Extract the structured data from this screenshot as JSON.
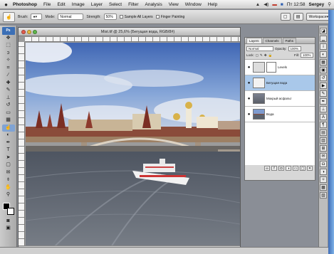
{
  "menubar": {
    "items": [
      "Photoshop",
      "File",
      "Edit",
      "Image",
      "Layer",
      "Select",
      "Filter",
      "Analysis",
      "View",
      "Window",
      "Help"
    ],
    "clock": "Пт 12:58",
    "user": "Sergey"
  },
  "options": {
    "brush_label": "Brush:",
    "mode_label": "Mode:",
    "mode_value": "Normal",
    "strength_label": "Strength:",
    "strength_value": "50%",
    "sample_all": "Sample All Layers",
    "finger": "Finger Painting",
    "workspace": "Workspace"
  },
  "document": {
    "title": "Mist.tif @ 25,6% (Бегущая вода, RGB/8#)"
  },
  "layers_panel": {
    "tabs": [
      "Layers",
      "Channels",
      "Paths"
    ],
    "blend_mode": "Normal",
    "opacity_label": "Opacity:",
    "opacity": "100%",
    "lock_label": "Lock:",
    "fill_label": "Fill:",
    "fill": "100%",
    "layers": [
      {
        "name": "Levels",
        "selected": false
      },
      {
        "name": "Бегущая вода",
        "selected": true
      },
      {
        "name": "Мокрый асфальт",
        "selected": false
      },
      {
        "name": "Вода",
        "selected": false
      }
    ]
  }
}
